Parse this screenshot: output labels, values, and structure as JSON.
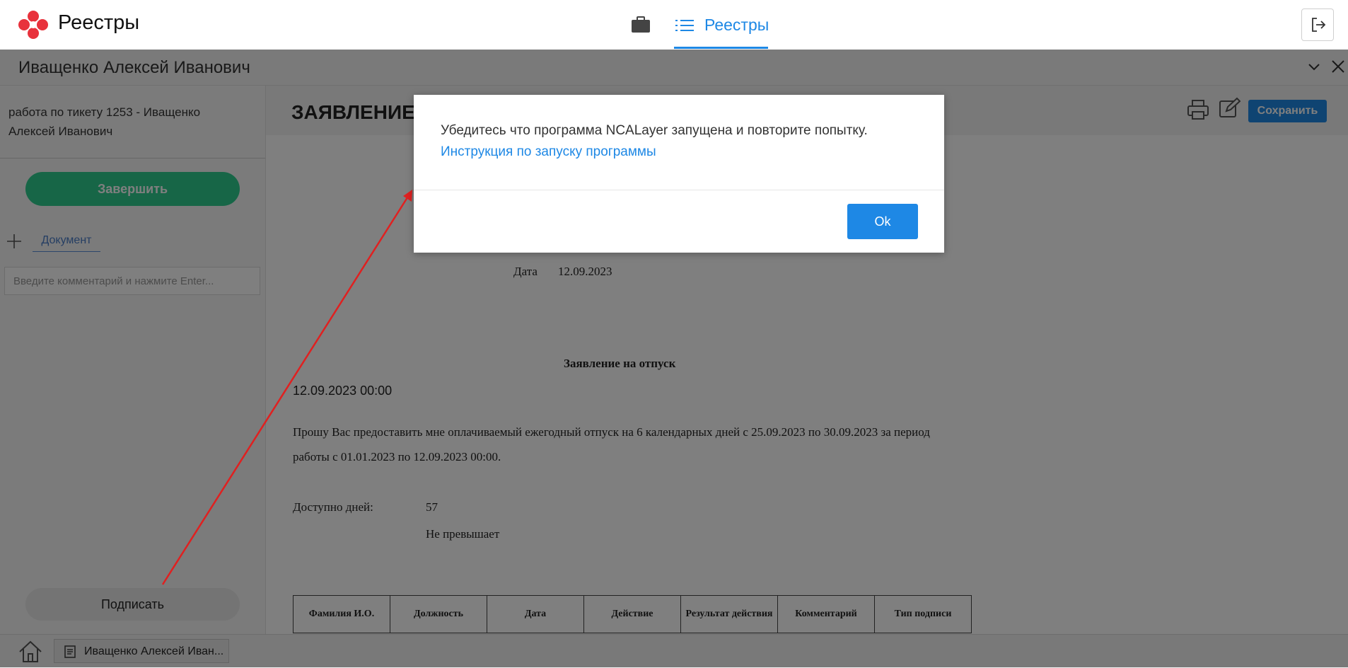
{
  "app": {
    "title": "Реестры"
  },
  "nav": {
    "active_tab": "Реестры"
  },
  "subheader": {
    "person": "Иващенко Алексей Иванович"
  },
  "left_panel": {
    "ticket": "работа по тикету 1253 - Иващенко Алексей Иванович",
    "finish_button": "Завершить",
    "tab_label": "Документ",
    "comment_placeholder": "Введите комментарий и нажмите Enter...",
    "sign_button": "Подписать"
  },
  "document": {
    "heading": "ЗАЯВЛЕНИЕ",
    "save_button": "Сохранить",
    "date_label": "Дата",
    "date_value": "12.09.2023",
    "title": "Заявление на отпуск",
    "datetime": "12.09.2023 00:00",
    "body": "Прошу Вас предоставить мне оплачиваемый ежегодный отпуск на 6 календарных дней с 25.09.2023 по 30.09.2023 за период работы с 01.01.2023 по 12.09.2023 00:00.",
    "available_label": "Доступно дней:",
    "available_value": "57",
    "available_status": "Не превышает",
    "table_headers": [
      "Фамилия И.О.",
      "Должность",
      "Дата",
      "Действие",
      "Результат действия",
      "Комментарий",
      "Тип подписи"
    ]
  },
  "taskbar": {
    "item_label": "Иващенко Алексей Иван..."
  },
  "modal": {
    "message": "Убедитесь что программа NCALayer запущена и повторите попытку.",
    "link": "Инструкция по запуску программы",
    "ok_button": "Ok"
  },
  "colors": {
    "accent": "#1e88e5",
    "success": "#2ecc8f",
    "logo": "#e8323c",
    "arrow": "#e02020"
  }
}
